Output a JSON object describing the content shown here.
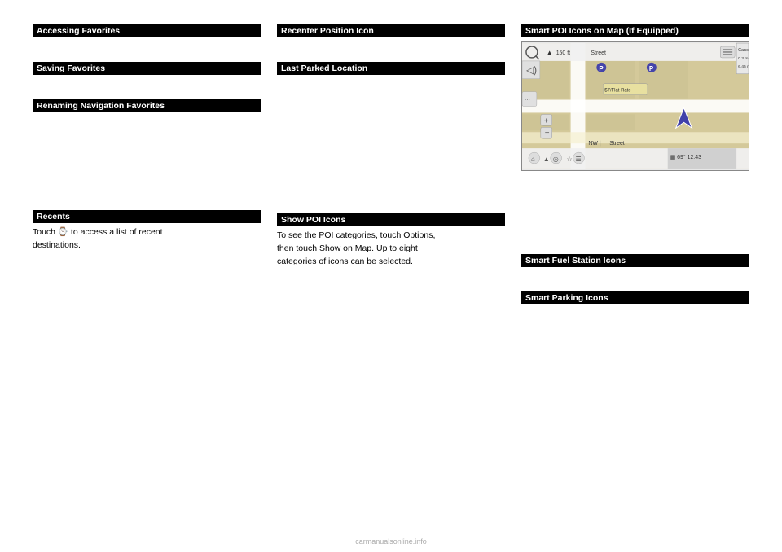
{
  "col1": {
    "section1": {
      "header": "Accessing Favorites",
      "content": ""
    },
    "section2": {
      "header": "Saving Favorites",
      "content": ""
    },
    "section3": {
      "header": "Renaming Navigation Favorites",
      "content": ""
    },
    "section4": {
      "header": "Recents",
      "content": "Touch  to access a list of recent\ndestinations."
    }
  },
  "col2": {
    "section1": {
      "header": "Recenter Position Icon",
      "content": ""
    },
    "section2": {
      "header": "Last Parked Location",
      "content": ""
    },
    "section3": {
      "header": "Show POI Icons",
      "content": "To see the POI categories, touch Options,\nthen touch Show on Map. Up to eight\ncategories of icons can be selected."
    }
  },
  "col3": {
    "section1": {
      "header": "Smart POI Icons on Map (If Equipped)",
      "content": ""
    },
    "section2": {
      "header": "Smart Fuel Station Icons",
      "content": ""
    },
    "section3": {
      "header": "Smart Parking Icons",
      "content": ""
    }
  },
  "watermark": "carmanualsonline.info",
  "map": {
    "distance1": "150 ft",
    "road1": "Street",
    "cancel": "Cancel",
    "dist2": "0.3 m",
    "dist3": "6.45 m",
    "price": "$7/Flat Rate",
    "direction": "NW |",
    "road2": "Street",
    "temp": "69°",
    "time": "12:43"
  }
}
